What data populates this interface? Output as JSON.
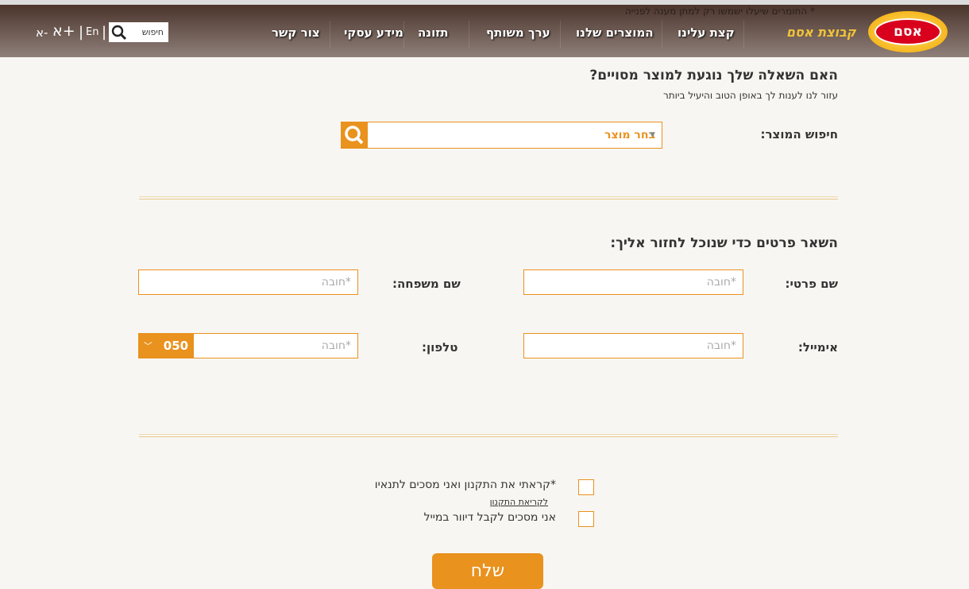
{
  "header": {
    "notice": "* החומרים שיעלו ישמשו רק למתן מענה לפנייה",
    "brand": "קבוצת אסם",
    "logo_text": "אסם",
    "nav": [
      "קצת עלינו",
      "המוצרים שלנו",
      "ערך משותף",
      "תזונה",
      "מידע עסקי",
      "צור קשר"
    ],
    "search_label": "חיפוש",
    "lang": "En",
    "font_increase": "א+",
    "font_decrease": "א-"
  },
  "product": {
    "title": "האם השאלה שלך נוגעת למוצר מסויים?",
    "subtitle": "עזור לנו לענות לך באופן הטוב והיעיל ביותר",
    "search_label": "חיפוש המוצר:",
    "select_value": "בחר מוצר"
  },
  "details": {
    "title": "השאר פרטים כדי שנוכל לחזור אליך:",
    "first_name_label": "שם פרטי:",
    "last_name_label": "שם משפחה:",
    "email_label": "אימייל:",
    "phone_label": "טלפון:",
    "placeholder": "*חובה",
    "phone_prefix": "050"
  },
  "consent": {
    "terms": "*קראתי את התקנון ואני מסכים לתנאיו",
    "terms_link": "לקריאת התקנון",
    "newsletter": "אני מסכים לקבל דיוור במייל"
  },
  "submit": "שלח",
  "colors": {
    "accent": "#e9921e",
    "logo_red": "#d8001c",
    "brand_yellow": "#f0c23a"
  }
}
